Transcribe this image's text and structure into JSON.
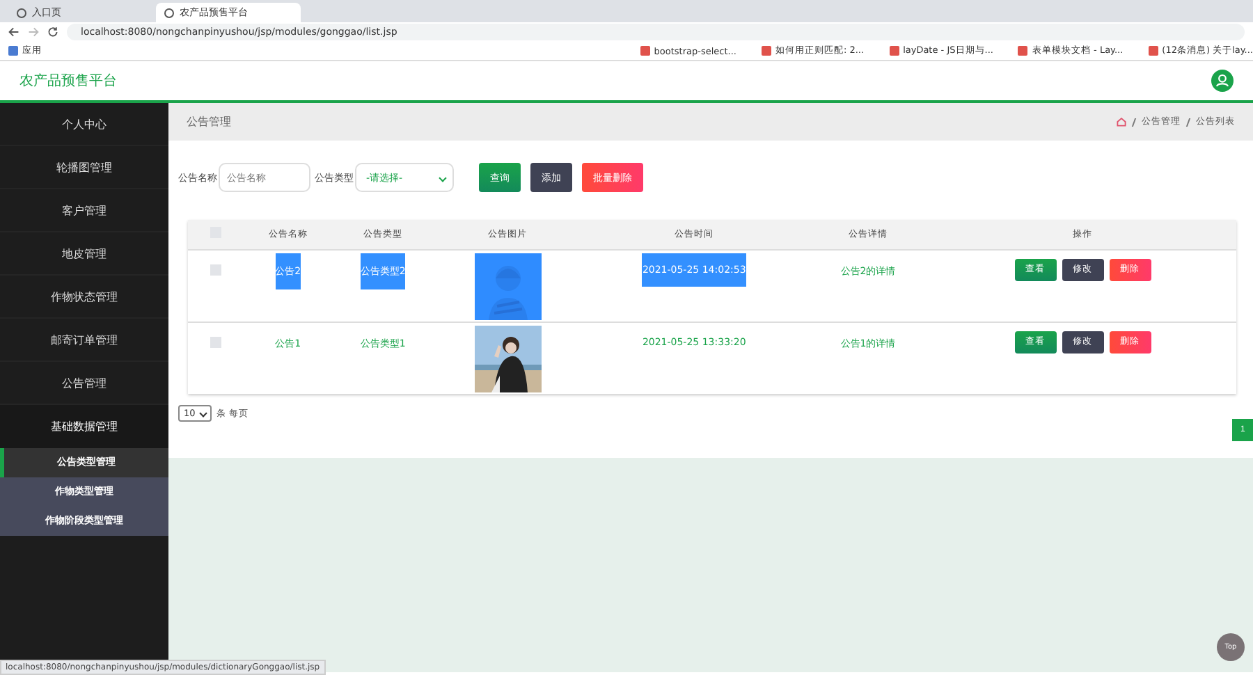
{
  "browser": {
    "tabs": [
      {
        "label": "入口页",
        "selected": false
      },
      {
        "label": "农产品预售平台",
        "selected": true
      }
    ],
    "address": "localhost:8080/nongchanpinyushou/jsp/modules/gonggao/list.jsp",
    "bookmarks": [
      "应用",
      "bootstrap-select...",
      "如何用正则匹配: 2...",
      "layDate - JS日期与...",
      "表单模块文档 - Lay...",
      "(12条消息) 关于lay..."
    ]
  },
  "app_title": "农产品预售平台",
  "sidebar": {
    "items": [
      {
        "label": "个人中心"
      },
      {
        "label": "轮播图管理"
      },
      {
        "label": "客户管理"
      },
      {
        "label": "地皮管理"
      },
      {
        "label": "作物状态管理"
      },
      {
        "label": "邮寄订单管理"
      },
      {
        "label": "公告管理"
      },
      {
        "label": "基础数据管理",
        "expanded": true,
        "children": [
          {
            "label": "公告类型管理",
            "selected": true
          },
          {
            "label": "作物类型管理",
            "selected": false
          },
          {
            "label": "作物阶段类型管理",
            "selected": false
          }
        ]
      }
    ]
  },
  "page_heading": "公告管理",
  "breadcrumb": [
    "公告管理",
    "公告列表"
  ],
  "filters": [
    {
      "label": "公告名称",
      "kind": "text",
      "placeholder": "公告名称"
    },
    {
      "label": "公告类型",
      "kind": "select",
      "value": "-请选择-"
    }
  ],
  "toolbar_buttons": [
    {
      "label": "查询",
      "kind": "search"
    },
    {
      "label": "添加",
      "kind": "add"
    },
    {
      "label": "批量删除",
      "kind": "delete"
    }
  ],
  "table": {
    "all_checked": false,
    "columns": [
      "公告名称",
      "公告类型",
      "公告图片",
      "公告时间",
      "公告详情",
      "操作"
    ],
    "rows": [
      {
        "checked": false,
        "highlighted": true,
        "cells": [
          "公告2",
          "公告类型2",
          "",
          "2021-05-25 14:02:53",
          "公告2的详情"
        ],
        "picture_tint": true,
        "actions": [
          "查看",
          "修改",
          "删除"
        ]
      },
      {
        "checked": false,
        "highlighted": false,
        "cells": [
          "公告1",
          "公告类型1",
          "",
          "2021-05-25 13:33:20",
          "公告1的详情"
        ],
        "picture_tint": false,
        "actions": [
          "查看",
          "修改",
          "删除"
        ]
      }
    ]
  },
  "page_size": {
    "value": "10",
    "suffix": "条 每页"
  },
  "pages": [
    {
      "label": "1",
      "selected": true
    }
  ],
  "top_button": "Top",
  "status_url": "localhost:8080/nongchanpinyushou/jsp/modules/dictionaryGonggao/list.jsp"
}
